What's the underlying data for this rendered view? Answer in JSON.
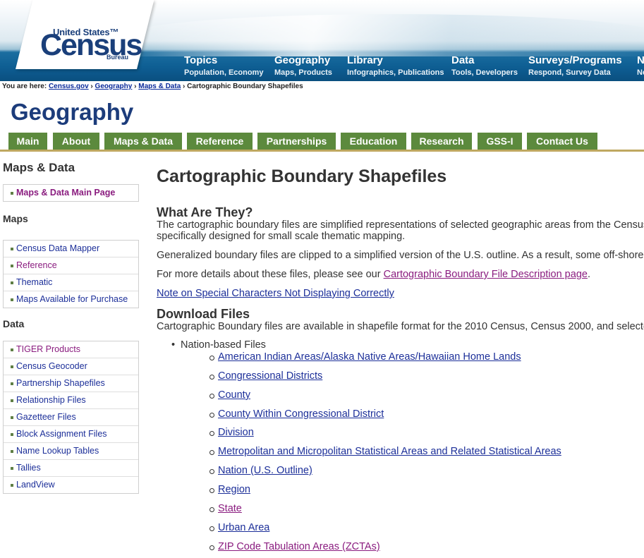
{
  "header": {
    "logo": {
      "line1": "United States™",
      "line2": "Census",
      "line3": "Bureau"
    },
    "nav": [
      {
        "title": "Topics",
        "subtitle": "Population, Economy"
      },
      {
        "title": "Geography",
        "subtitle": "Maps, Products"
      },
      {
        "title": "Library",
        "subtitle": "Infographics, Publications"
      },
      {
        "title": "Data",
        "subtitle": "Tools, Developers"
      },
      {
        "title": "Surveys/Programs",
        "subtitle": "Respond, Survey Data"
      },
      {
        "title": "N",
        "subtitle": "Ne"
      }
    ]
  },
  "breadcrumb": {
    "prefix": "You are here:",
    "links": [
      "Census.gov",
      "Geography",
      "Maps & Data"
    ],
    "separator": "›",
    "current": "Cartographic Boundary Shapefiles"
  },
  "section": {
    "title": "Geography",
    "tabs": [
      "Main",
      "About",
      "Maps & Data",
      "Reference",
      "Partnerships",
      "Education",
      "Research",
      "GSS-I",
      "Contact Us"
    ]
  },
  "sidebar": {
    "heading": "Maps & Data",
    "top_items": [
      "Maps & Data Main Page"
    ],
    "maps_heading": "Maps",
    "maps_items": [
      "Census Data Mapper",
      "Reference",
      "Thematic",
      "Maps Available for Purchase"
    ],
    "data_heading": "Data",
    "data_items": [
      "TIGER Products",
      "Census Geocoder",
      "Partnership Shapefiles",
      "Relationship Files",
      "Gazetteer Files",
      "Block Assignment Files",
      "Name Lookup Tables",
      "Tallies",
      "LandView"
    ]
  },
  "main": {
    "title": "Cartographic Boundary Shapefiles",
    "what_heading": "What Are They?",
    "what_p1_line1": "The cartographic boundary files are simplified representations of selected geographic areas from the Census",
    "what_p1_line2": "specifically designed for small scale thematic mapping.",
    "what_p2": "Generalized boundary files are clipped to a simplified version of the U.S. outline.  As a result, some off-shore a",
    "what_p3_prefix": "For more details about these files, please see our ",
    "what_p3_link": "Cartographic Boundary File Description page",
    "what_p3_suffix": ".",
    "note_link": "Note on Special Characters Not Displaying Correctly",
    "download_heading": "Download Files",
    "download_p": "Cartographic Boundary files are available in shapefile format for the 2010 Census, Census 2000, and selected",
    "nation_label": "Nation-based Files",
    "nation_items": [
      "American Indian Areas/Alaska Native Areas/Hawaiian Home Lands",
      "Congressional Districts",
      "County",
      "County Within Congressional District",
      "Division",
      "Metropolitan and Micropolitan Statistical Areas and Related Statistical Areas",
      "Nation (U.S. Outline)",
      "Region",
      "State",
      "Urban Area",
      "ZIP Code Tabulation Areas (ZCTAs)"
    ]
  },
  "colors": {
    "header_blue": "#0e5e93",
    "title_navy": "#1c3c7b",
    "tab_green": "#5c8a3d",
    "rule_gold": "#bfa860",
    "link_blue": "#1c2f99",
    "link_visited": "#8a1c7f"
  }
}
